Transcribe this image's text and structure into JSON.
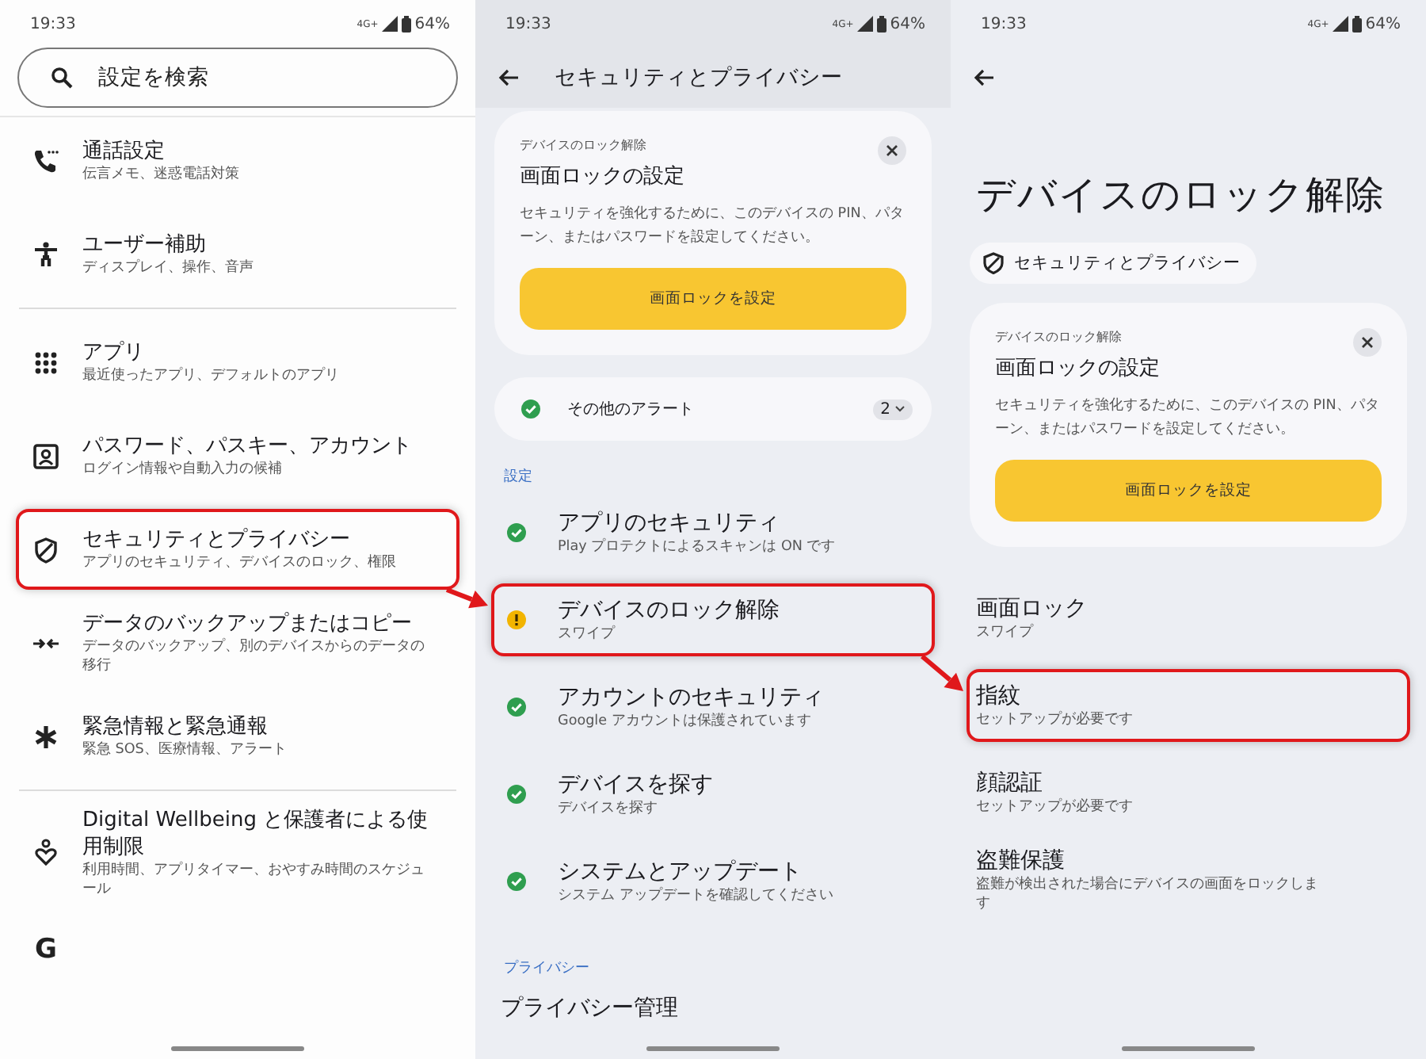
{
  "settings_home": {
    "status_bar": {
      "time": "19:33",
      "network": "4G+",
      "battery": "64%"
    },
    "search": {
      "placeholder": "設定を検索"
    },
    "items": [
      {
        "kind": "item",
        "title": "通話設定",
        "subtitle": "伝言メモ、迷惑電話対策",
        "highlighted": false
      },
      {
        "kind": "item",
        "title": "ユーザー補助",
        "subtitle": "ディスプレイ、操作、音声",
        "highlighted": false
      },
      {
        "kind": "divider"
      },
      {
        "kind": "item",
        "title": "アプリ",
        "subtitle": "最近使ったアプリ、デフォルトのアプリ",
        "highlighted": false
      },
      {
        "kind": "item",
        "title": "パスワード、パスキー、アカウント",
        "subtitle": "ログイン情報や自動入力の候補",
        "highlighted": false
      },
      {
        "kind": "item",
        "title": "セキュリティとプライバシー",
        "subtitle": "アプリのセキュリティ、デバイスのロック、権限",
        "highlighted": true
      },
      {
        "kind": "item",
        "title": "データのバックアップまたはコピー",
        "subtitle": "データのバックアップ、別のデバイスからのデータの移行",
        "highlighted": false
      },
      {
        "kind": "item",
        "title": "緊急情報と緊急通報",
        "subtitle": "緊急 SOS、医療情報、アラート",
        "highlighted": false
      },
      {
        "kind": "divider"
      },
      {
        "kind": "item",
        "title": "Digital Wellbeing と保護者による使用制限",
        "subtitle": "利用時間、アプリタイマー、おやすみ時間のスケジュール",
        "highlighted": false
      },
      {
        "kind": "glyph",
        "glyph": "G"
      }
    ]
  },
  "security_privacy": {
    "status_bar": {
      "time": "19:33",
      "network": "4G+",
      "battery": "64%"
    },
    "title": "セキュリティとプライバシー",
    "card": {
      "label": "デバイスのロック解除",
      "title": "画面ロックの設定",
      "description": "セキュリティを強化するために、このデバイスの PIN、パターン、またはパスワードを設定してください。",
      "button": "画面ロックを設定"
    },
    "alerts": {
      "label": "その他のアラート",
      "count": "2"
    },
    "sections": [
      {
        "header": "設定",
        "items": [
          {
            "kind": "ok",
            "title": "アプリのセキュリティ",
            "subtitle": "Play プロテクトによるスキャンは ON です",
            "highlighted": false
          },
          {
            "kind": "warning",
            "title": "デバイスのロック解除",
            "subtitle": "スワイプ",
            "highlighted": true
          },
          {
            "kind": "ok",
            "title": "アカウントのセキュリティ",
            "subtitle": "Google アカウントは保護されています",
            "highlighted": false
          },
          {
            "kind": "ok",
            "title": "デバイスを探す",
            "subtitle": "デバイスを探す",
            "highlighted": false
          },
          {
            "kind": "ok",
            "title": "システムとアップデート",
            "subtitle": "システム アップデートを確認してください",
            "highlighted": false
          }
        ]
      },
      {
        "header": "プライバシー",
        "items": [
          {
            "title": "プライバシー管理",
            "highlighted": false
          }
        ]
      }
    ]
  },
  "device_unlock": {
    "status_bar": {
      "time": "19:33",
      "network": "4G+",
      "battery": "64%"
    },
    "title": "デバイスのロック解除",
    "breadcrumb": "セキュリティとプライバシー",
    "card": {
      "label": "デバイスのロック解除",
      "title": "画面ロックの設定",
      "description": "セキュリティを強化するために、このデバイスの PIN、パターン、またはパスワードを設定してください。",
      "button": "画面ロックを設定"
    },
    "items": [
      {
        "title": "画面ロック",
        "subtitle": "スワイプ",
        "highlighted": false
      },
      {
        "title": "指紋",
        "subtitle": "セットアップが必要です",
        "highlighted": true
      },
      {
        "title": "顔認証",
        "subtitle": "セットアップが必要です",
        "highlighted": false
      },
      {
        "title": "盗難保護",
        "subtitle": "盗難が検出された場合にデバイスの画面をロックします",
        "highlighted": false
      }
    ]
  }
}
